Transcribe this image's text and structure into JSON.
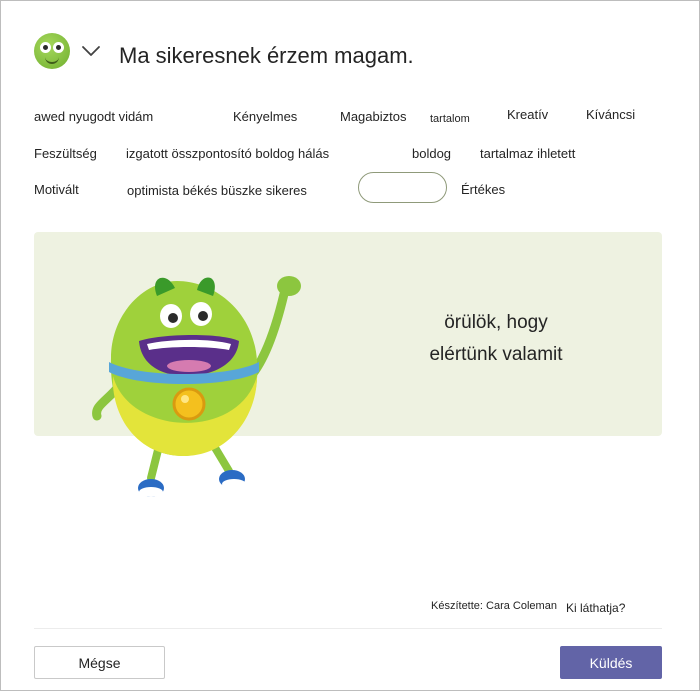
{
  "header": {
    "title": "Ma sikeresnek érzem magam.",
    "mood_icon": "green-monster-face-icon",
    "dropdown_icon": "chevron-down-icon"
  },
  "words": {
    "row1": [
      "awed nyugodt vidám",
      "Kényelmes",
      "Magabiztos",
      "tartalom",
      "Kreatív",
      "Kíváncsi"
    ],
    "row2": [
      "Feszültség",
      "izgatott összpontosító boldog hálás",
      "boldog",
      "tartalmaz ihletett"
    ],
    "row3": [
      "Motivált",
      "optimista békés büszke sikeres",
      "Értékes"
    ]
  },
  "card": {
    "phrase_line1": "örülök, hogy",
    "phrase_line2": "elértünk valamit",
    "illustration": "waving-green-monster-icon"
  },
  "footer": {
    "credit": "Készítette: Cara Coleman",
    "visibility_link": "Ki láthatja?",
    "cancel_label": "Mégse",
    "send_label": "Küldés"
  },
  "colors": {
    "accent": "#6264a7",
    "panel_bg": "#eef2e1",
    "monster_green": "#8cc63f"
  }
}
